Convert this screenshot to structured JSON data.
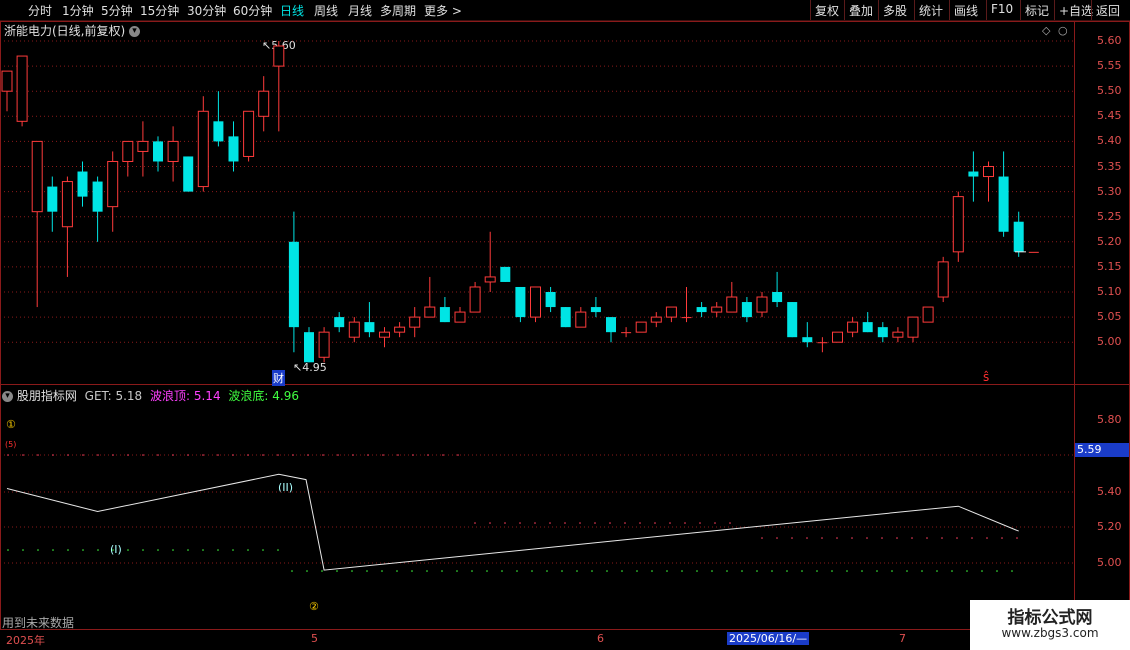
{
  "toolbar": {
    "left": [
      "分时",
      "1分钟",
      "5分钟",
      "15分钟",
      "30分钟",
      "60分钟",
      "日线",
      "周线",
      "月线",
      "多周期",
      "更多 >"
    ],
    "active_index": 6,
    "right": [
      "复权",
      "叠加",
      "多股",
      "统计",
      "画线",
      "F10",
      "标记",
      "+自选",
      "返回"
    ]
  },
  "main": {
    "stock_title": "浙能电力(日线,前复权)",
    "high_marker": "5.60",
    "low_marker": "4.95",
    "finance_tag": "财",
    "signal_mark": "ŝ",
    "price_axis": [
      "5.60",
      "5.55",
      "5.50",
      "5.45",
      "5.40",
      "5.35",
      "5.30",
      "5.25",
      "5.20",
      "5.15",
      "5.10",
      "5.05",
      "5.00"
    ]
  },
  "indicator": {
    "name": "股朋指标网",
    "get_label": "GET:",
    "get_value": "5.18",
    "top_label": "波浪顶:",
    "top_value": "5.14",
    "bottom_label": "波浪底:",
    "bottom_value": "4.96",
    "axis": [
      "5.80",
      "5.40",
      "5.20",
      "5.00"
    ],
    "current_value": "5.59",
    "wave1_label": "(I)",
    "wave2_label": "(II)",
    "circle1": "①",
    "circle2": "②",
    "small_mark": "(5)",
    "footer_note": "用到未来数据"
  },
  "dates": {
    "year": "2025年",
    "m5": "5",
    "m6": "6",
    "cursor_date": "2025/06/16/—",
    "m7": "7"
  },
  "watermark": {
    "title": "指标公式网",
    "url": "www.zbgs3.com"
  },
  "colors": {
    "up": "#ff3b3b",
    "down": "#00e5e5",
    "grid": "#8a1a1a",
    "axis_text": "#e05050"
  },
  "chart_data": {
    "type": "candlestick",
    "ylim": [
      4.97,
      5.63
    ],
    "candles": [
      [
        5.5,
        5.54,
        5.46,
        5.52
      ],
      [
        5.44,
        5.57,
        5.43,
        5.5
      ],
      [
        5.26,
        5.4,
        5.07,
        5.31
      ],
      [
        5.31,
        5.26,
        5.22,
        5.33
      ],
      [
        5.23,
        5.32,
        5.13,
        5.33
      ],
      [
        5.34,
        5.29,
        5.27,
        5.36
      ],
      [
        5.32,
        5.26,
        5.2,
        5.33
      ],
      [
        5.27,
        5.36,
        5.22,
        5.38
      ],
      [
        5.36,
        5.4,
        5.33,
        5.4
      ],
      [
        5.38,
        5.4,
        5.33,
        5.44
      ],
      [
        5.4,
        5.36,
        5.34,
        5.41
      ],
      [
        5.36,
        5.4,
        5.32,
        5.43
      ],
      [
        5.37,
        5.3,
        5.3,
        5.37
      ],
      [
        5.31,
        5.46,
        5.3,
        5.49
      ],
      [
        5.44,
        5.4,
        5.39,
        5.5
      ],
      [
        5.41,
        5.36,
        5.34,
        5.44
      ],
      [
        5.37,
        5.46,
        5.36,
        5.46
      ],
      [
        5.45,
        5.5,
        5.42,
        5.53
      ],
      [
        5.55,
        5.59,
        5.42,
        5.6
      ],
      [
        5.2,
        5.03,
        4.98,
        5.26
      ],
      [
        5.02,
        4.96,
        4.96,
        5.03
      ],
      [
        4.97,
        5.02,
        4.96,
        5.03
      ],
      [
        5.05,
        5.03,
        5.02,
        5.06
      ],
      [
        5.01,
        5.04,
        5.0,
        5.05
      ],
      [
        5.04,
        5.02,
        5.01,
        5.08
      ],
      [
        5.01,
        5.02,
        4.99,
        5.03
      ],
      [
        5.02,
        5.03,
        5.01,
        5.04
      ],
      [
        5.03,
        5.05,
        5.01,
        5.07
      ],
      [
        5.05,
        5.07,
        5.05,
        5.13
      ],
      [
        5.07,
        5.04,
        5.04,
        5.09
      ],
      [
        5.04,
        5.06,
        5.04,
        5.07
      ],
      [
        5.06,
        5.11,
        5.06,
        5.12
      ],
      [
        5.12,
        5.13,
        5.1,
        5.22
      ],
      [
        5.15,
        5.12,
        5.12,
        5.15
      ],
      [
        5.11,
        5.05,
        5.04,
        5.11
      ],
      [
        5.05,
        5.11,
        5.04,
        5.11
      ],
      [
        5.1,
        5.07,
        5.06,
        5.11
      ],
      [
        5.07,
        5.03,
        5.03,
        5.07
      ],
      [
        5.03,
        5.06,
        5.03,
        5.07
      ],
      [
        5.07,
        5.06,
        5.05,
        5.09
      ],
      [
        5.05,
        5.02,
        5.0,
        5.05
      ],
      [
        5.02,
        5.02,
        5.01,
        5.03
      ],
      [
        5.02,
        5.04,
        5.02,
        5.04
      ],
      [
        5.04,
        5.05,
        5.03,
        5.06
      ],
      [
        5.05,
        5.07,
        5.04,
        5.07
      ],
      [
        5.05,
        5.05,
        5.04,
        5.11
      ],
      [
        5.07,
        5.06,
        5.05,
        5.08
      ],
      [
        5.06,
        5.07,
        5.05,
        5.08
      ],
      [
        5.06,
        5.09,
        5.06,
        5.12
      ],
      [
        5.08,
        5.05,
        5.04,
        5.09
      ],
      [
        5.06,
        5.09,
        5.05,
        5.1
      ],
      [
        5.1,
        5.08,
        5.07,
        5.14
      ],
      [
        5.08,
        5.01,
        5.01,
        5.08
      ],
      [
        5.01,
        5.0,
        4.99,
        5.04
      ],
      [
        5.0,
        5.0,
        4.98,
        5.01
      ],
      [
        5.0,
        5.02,
        5.0,
        5.02
      ],
      [
        5.02,
        5.04,
        5.01,
        5.05
      ],
      [
        5.04,
        5.02,
        5.02,
        5.06
      ],
      [
        5.03,
        5.01,
        5.0,
        5.04
      ],
      [
        5.01,
        5.02,
        5.0,
        5.03
      ],
      [
        5.01,
        5.05,
        5.0,
        5.05
      ],
      [
        5.04,
        5.07,
        5.04,
        5.07
      ],
      [
        5.09,
        5.16,
        5.08,
        5.17
      ],
      [
        5.18,
        5.29,
        5.16,
        5.3
      ],
      [
        5.34,
        5.33,
        5.28,
        5.38
      ],
      [
        5.33,
        5.35,
        5.28,
        5.36
      ],
      [
        5.33,
        5.22,
        5.21,
        5.38
      ],
      [
        5.24,
        5.18,
        5.17,
        5.26
      ],
      [
        5.18,
        5.18,
        5.18,
        5.18
      ]
    ],
    "wave_line": [
      [
        0,
        5.42
      ],
      [
        6,
        5.29
      ],
      [
        18,
        5.5
      ],
      [
        19.8,
        5.47
      ],
      [
        21,
        4.96
      ],
      [
        63,
        5.32
      ],
      [
        67,
        5.18
      ]
    ],
    "wave_top_dots": 5.62,
    "wave_bottom_dots": 4.96
  }
}
